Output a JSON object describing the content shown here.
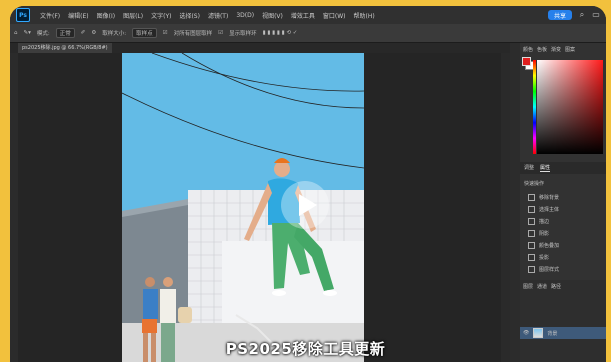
{
  "app": {
    "logo": "Ps"
  },
  "menu": {
    "items": [
      "文件(F)",
      "编辑(E)",
      "图像(I)",
      "图层(L)",
      "文字(Y)",
      "选择(S)",
      "滤镜(T)",
      "3D(D)",
      "视图(V)",
      "增效工具",
      "窗口(W)",
      "帮助(H)"
    ]
  },
  "header": {
    "share_label": "共享"
  },
  "options": {
    "mode_label": "模式:",
    "mode_value": "正常",
    "sample_label": "取样大小:",
    "sample_value": "取样点",
    "contiguous_label": "对所有图层取样",
    "autofill_label": "显示取样环"
  },
  "document": {
    "tab_label": "ps2025移除.jpg @ 66.7%(RGB/8#)"
  },
  "panels": {
    "color_tabs": [
      "颜色",
      "色板",
      "渐变",
      "图案"
    ],
    "props_tabs": [
      "调整",
      "属性"
    ],
    "props_title": "快速操作",
    "props_items": [
      "移除背景",
      "选择主体",
      "描边",
      "阴影",
      "颜色叠加",
      "投影",
      "图层样式"
    ],
    "layers_tabs": [
      "图层",
      "通道",
      "路径"
    ],
    "layer_name": "背景"
  },
  "video": {
    "subtitle": "PS2025移除工具更新"
  },
  "colors": {
    "accent": "#2680eb",
    "frame": "#f2c13d",
    "foreground": "#e02020"
  }
}
